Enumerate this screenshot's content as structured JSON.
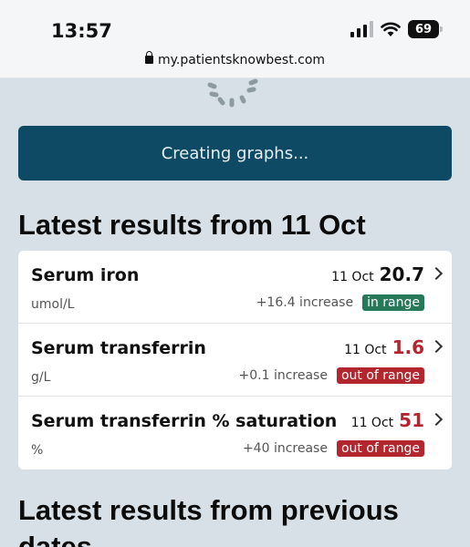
{
  "status_bar": {
    "time": "13:57",
    "battery": "69"
  },
  "browser": {
    "url": "my.patientsknowbest.com"
  },
  "banner": {
    "text": "Creating graphs..."
  },
  "latest": {
    "title": "Latest results from 11 Oct",
    "rows": [
      {
        "name": "Serum iron",
        "unit": "umol/L",
        "date": "11 Oct",
        "value": "20.7",
        "change": "+16.4 increase",
        "status": "in range"
      },
      {
        "name": "Serum transferrin",
        "unit": "g/L",
        "date": "11 Oct",
        "value": "1.6",
        "change": "+0.1 increase",
        "status": "out of range"
      },
      {
        "name": "Serum transferrin % saturation",
        "unit": "%",
        "date": "11 Oct",
        "value": "51",
        "change": "+40 increase",
        "status": "out of range"
      }
    ]
  },
  "previous": {
    "title": "Latest results from previous dates"
  },
  "colors": {
    "banner": "#0e4a63",
    "in_range": "#27795a",
    "out_of_range": "#b3262d"
  }
}
